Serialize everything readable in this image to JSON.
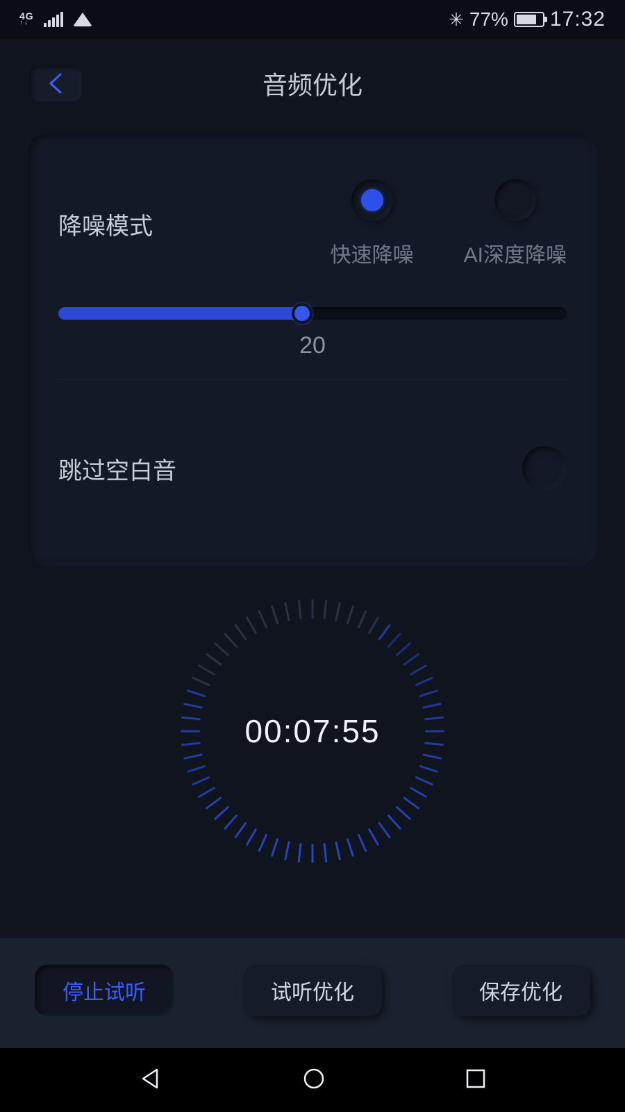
{
  "status": {
    "network": "4G",
    "battery_pct": "77%",
    "clock": "17:32"
  },
  "header": {
    "title": "音频优化"
  },
  "noise": {
    "label": "降噪模式",
    "options": {
      "fast": "快速降噪",
      "ai": "AI深度降噪"
    },
    "slider_value": "20"
  },
  "skip": {
    "label": "跳过空白音"
  },
  "dial": {
    "time": "00:07:55"
  },
  "actions": {
    "stop": "停止试听",
    "preview": "试听优化",
    "save": "保存优化"
  }
}
